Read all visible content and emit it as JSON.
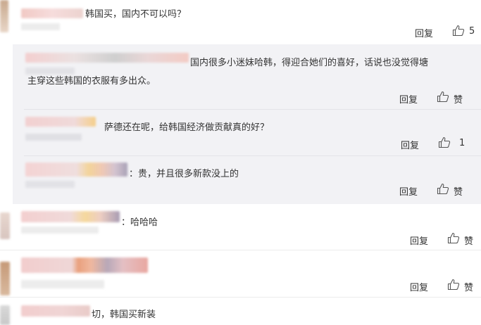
{
  "comments": [
    {
      "text": "韩国买，国内不可以吗？",
      "reply": "回复",
      "like_count": "5"
    },
    {
      "text_line1": "国内很多小迷妹哈韩，得迎合她们的喜好，话说也没觉得塘",
      "text_line2": "主穿这些韩国的衣服有多出众。",
      "reply": "回复",
      "like_label": "赞"
    },
    {
      "text": "萨德还在呢，给韩国经济做贡献真的好？",
      "reply": "回复",
      "like_count": "1"
    },
    {
      "text": "：贵，并且很多新款没上的",
      "reply": "回复",
      "like_label": "赞"
    },
    {
      "text": "：哈哈哈",
      "reply": "回复",
      "like_label": "赞"
    },
    {
      "reply": "回复",
      "like_label": "赞"
    },
    {
      "text": "切，韩国买新装"
    }
  ],
  "colors": {
    "panel_bg": "#f2f2f5",
    "text": "#333333",
    "separator": "#e3e3e8"
  }
}
